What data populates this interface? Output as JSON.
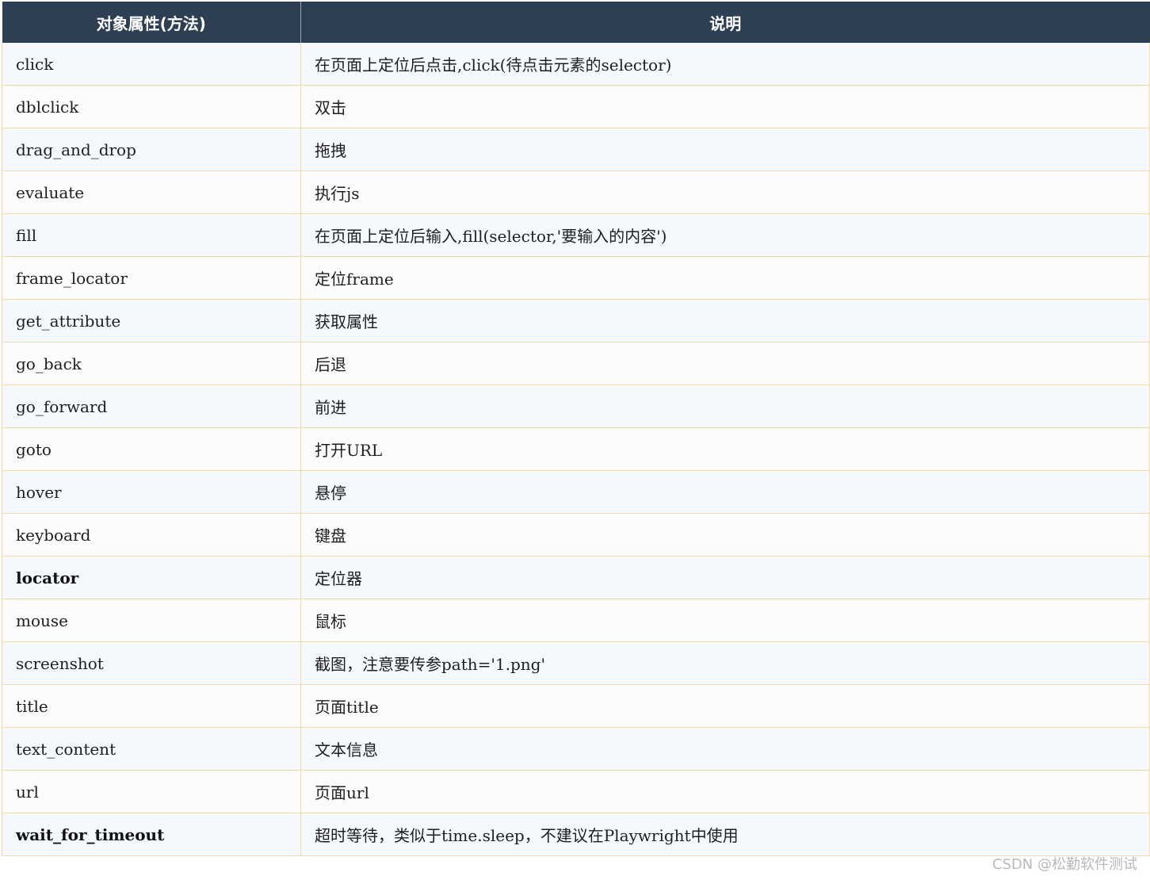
{
  "table": {
    "headers": [
      "对象属性(方法)",
      "说明"
    ],
    "rows": [
      {
        "method": "click",
        "description": "在页面上定位后点击,click(待点击元素的selector)",
        "bold": false
      },
      {
        "method": "dblclick",
        "description": "双击",
        "bold": false
      },
      {
        "method": "drag_and_drop",
        "description": "拖拽",
        "bold": false
      },
      {
        "method": "evaluate",
        "description": "执行js",
        "bold": false
      },
      {
        "method": "fill",
        "description": "在页面上定位后输入,fill(selector,'要输入的内容')",
        "bold": false
      },
      {
        "method": "frame_locator",
        "description": "定位frame",
        "bold": false
      },
      {
        "method": "get_attribute",
        "description": "获取属性",
        "bold": false
      },
      {
        "method": "go_back",
        "description": "后退",
        "bold": false
      },
      {
        "method": "go_forward",
        "description": "前进",
        "bold": false
      },
      {
        "method": "goto",
        "description": "打开URL",
        "bold": false
      },
      {
        "method": "hover",
        "description": "悬停",
        "bold": false
      },
      {
        "method": "keyboard",
        "description": "键盘",
        "bold": false
      },
      {
        "method": "locator",
        "description": "定位器",
        "bold": true
      },
      {
        "method": "mouse",
        "description": "鼠标",
        "bold": false
      },
      {
        "method": "screenshot",
        "description": "截图，注意要传参path='1.png'",
        "bold": false
      },
      {
        "method": "title",
        "description": "页面title",
        "bold": false
      },
      {
        "method": "text_content",
        "description": "文本信息",
        "bold": false
      },
      {
        "method": "url",
        "description": "页面url",
        "bold": false
      },
      {
        "method": "wait_for_timeout",
        "description": "超时等待，类似于time.sleep，不建议在Playwright中使用",
        "bold": true
      }
    ]
  },
  "watermark": "CSDN @松勤软件测试",
  "colors": {
    "header_bg": "#2e3f53",
    "header_text": "#ffffff",
    "row_border": "#f6d9a3",
    "row_odd_bg": "#f5f8fd",
    "row_even_bg": "#fdfcfb"
  }
}
